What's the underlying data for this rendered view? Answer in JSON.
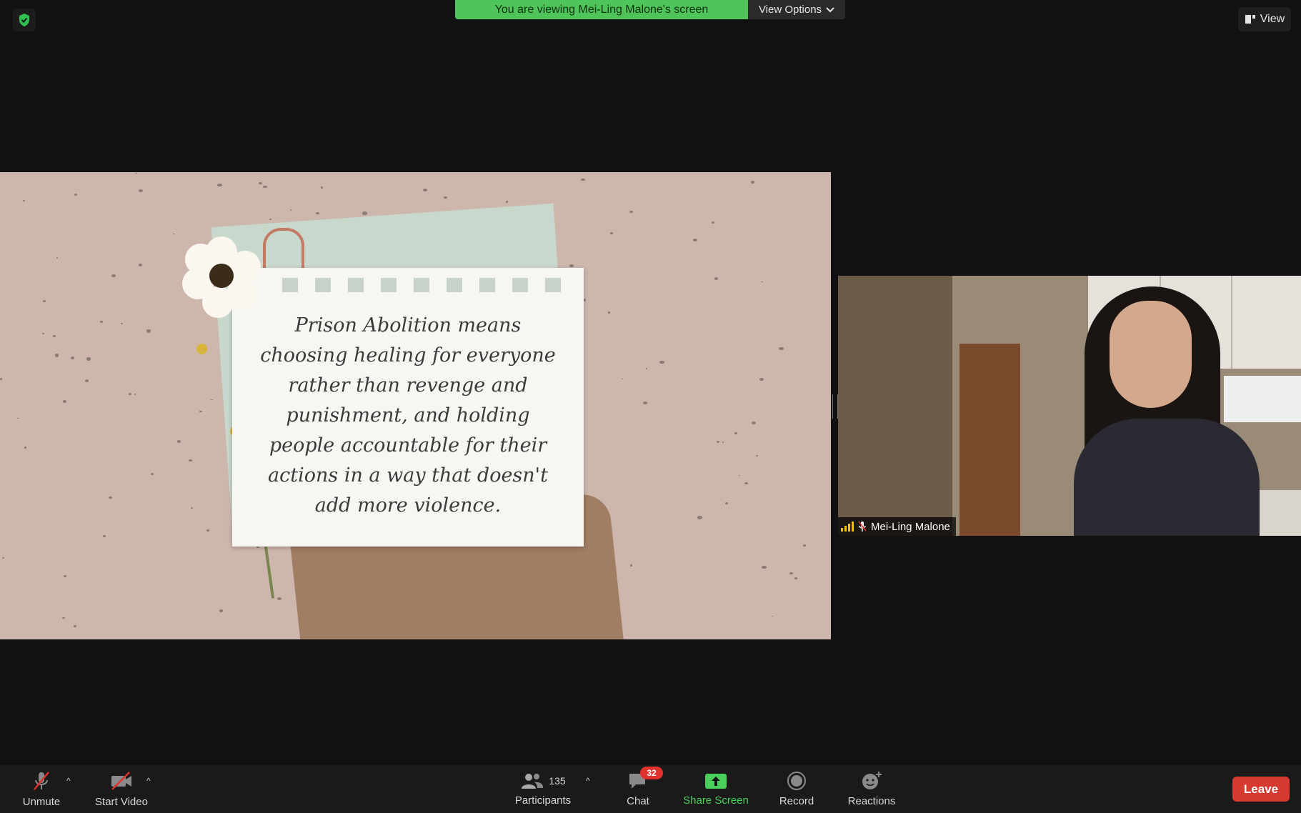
{
  "banner": {
    "viewing_text": "You are viewing Mei-Ling Malone's screen",
    "view_options_label": "View Options"
  },
  "top_right": {
    "view_label": "View"
  },
  "shared_screen": {
    "quote_lines": [
      "Prison Abolition means",
      "choosing healing for everyone",
      "rather than revenge and",
      "punishment, and holding",
      "people accountable for their",
      "actions in a way that doesn't",
      "add more violence."
    ]
  },
  "participant": {
    "name": "Mei-Ling Malone"
  },
  "toolbar": {
    "unmute_label": "Unmute",
    "start_video_label": "Start Video",
    "participants_label": "Participants",
    "participants_count": "135",
    "chat_label": "Chat",
    "chat_badge": "32",
    "share_screen_label": "Share Screen",
    "record_label": "Record",
    "reactions_label": "Reactions",
    "leave_label": "Leave"
  },
  "colors": {
    "banner_green": "#4fc45a",
    "share_green": "#48d05a",
    "leave_red": "#d63b31",
    "badge_red": "#e0312f"
  },
  "icons": {
    "security": "shield-check-icon",
    "view": "view-layout-icon",
    "unmute": "microphone-muted-icon",
    "video": "video-camera-off-icon",
    "participants": "people-icon",
    "chat": "chat-bubble-icon",
    "share": "share-screen-icon",
    "record": "record-icon",
    "reactions": "emoji-plus-icon"
  }
}
